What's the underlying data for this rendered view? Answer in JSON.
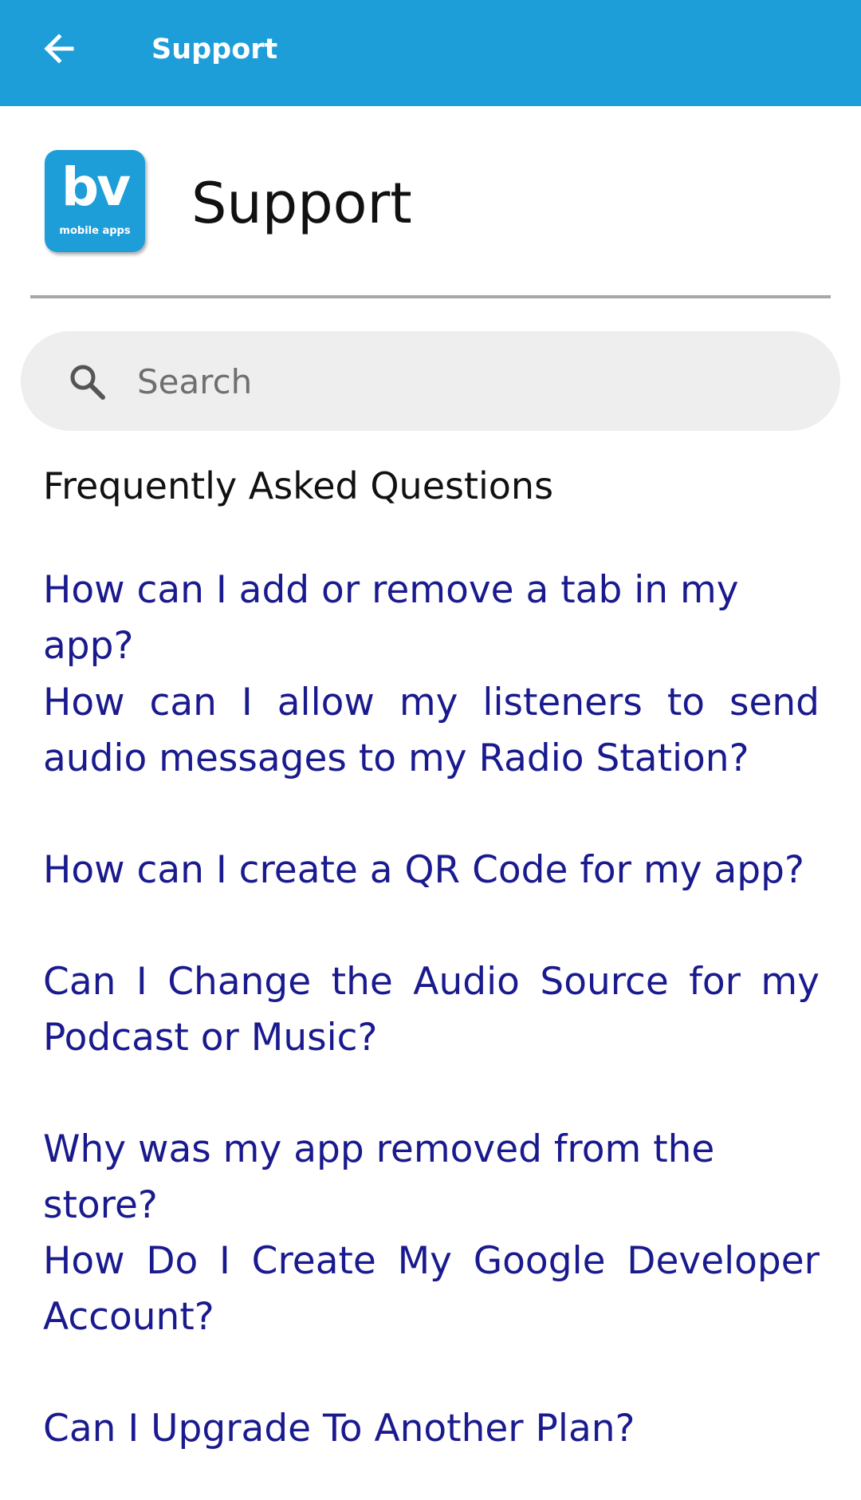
{
  "appbar": {
    "title": "Support",
    "back_icon": "arrow-left-icon",
    "color": "#1e9ed9"
  },
  "header": {
    "logo_mark": "bv",
    "logo_sub": "mobile apps",
    "title": "Support"
  },
  "search": {
    "placeholder": "Search",
    "value": "",
    "icon": "search-icon"
  },
  "faq": {
    "heading": "Frequently Asked Questions",
    "link_color": "#1a1a8f",
    "items": [
      {
        "label": "How can I add or remove a tab in my app?"
      },
      {
        "label": "How can I allow my listeners to send audio messages to my Radio Station?"
      },
      {
        "label": "How can I create a QR Code for my app?"
      },
      {
        "label": "Can I Change the Audio Source for my Podcast or Music?"
      },
      {
        "label": "Why was my app removed from the store?"
      },
      {
        "label": "How Do I Create My Google Developer Account?"
      },
      {
        "label": "Can I Upgrade To Another Plan?"
      }
    ]
  }
}
